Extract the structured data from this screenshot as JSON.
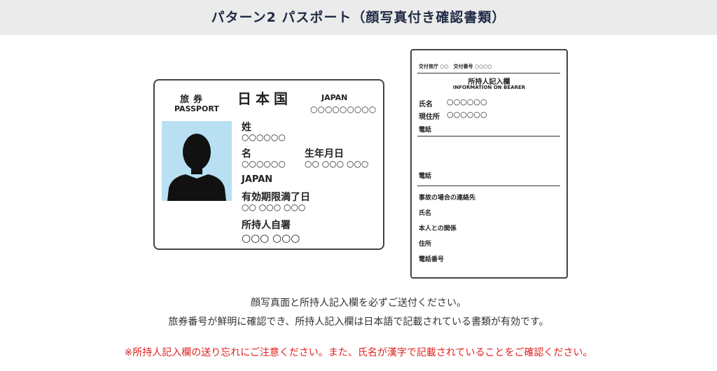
{
  "header": {
    "title": "パターン2 パスポート（顔写真付き確認書類）"
  },
  "passport": {
    "ryoken": "旅券",
    "passport_en": "PASSPORT",
    "country_jp": "日本国",
    "country_en": "JAPAN",
    "number": "○○○○○○○○○",
    "surname_label": "姓",
    "surname_value": "○○○○○○",
    "given_label": "名",
    "given_value": "○○○○○○",
    "birth_label": "生年月日",
    "birth_value": "○○ ○○○ ○○○",
    "nationality": "JAPAN",
    "expiry_label": "有効期限満了日",
    "expiry_value": "○○ ○○○ ○○○",
    "signature_label": "所持人自署",
    "signature_value": "○○○ ○○○"
  },
  "bearer": {
    "top_line": "交付官庁 ○○　交付番号 ○○○○",
    "title": "所持人記入欄",
    "title_en": "INFORMATION ON BEARER",
    "name_label": "氏名",
    "name_value": "○○○○○○",
    "address_label": "現住所",
    "address_value": "○○○○○○",
    "tel1_label": "電話",
    "tel2_label": "電話",
    "emergency_label": "事故の場合の連絡先",
    "emergency_name_label": "氏名",
    "relation_label": "本人との関係",
    "emergency_address_label": "住所",
    "emergency_tel_label": "電話番号"
  },
  "notes": {
    "line1": "顔写真面と所持人記入欄を必ずご送付ください。",
    "line2": "旅券番号が鮮明に確認でき、所持人記入欄は日本語で記載されている書類が有効です。",
    "warning": "※所持人記入欄の送り忘れにご注意ください。また、氏名が漢字で記載されていることをご確認ください。"
  },
  "colors": {
    "warning": "#e0201c",
    "header_bg": "#ebebeb",
    "photo_bg": "#b8dff2"
  }
}
